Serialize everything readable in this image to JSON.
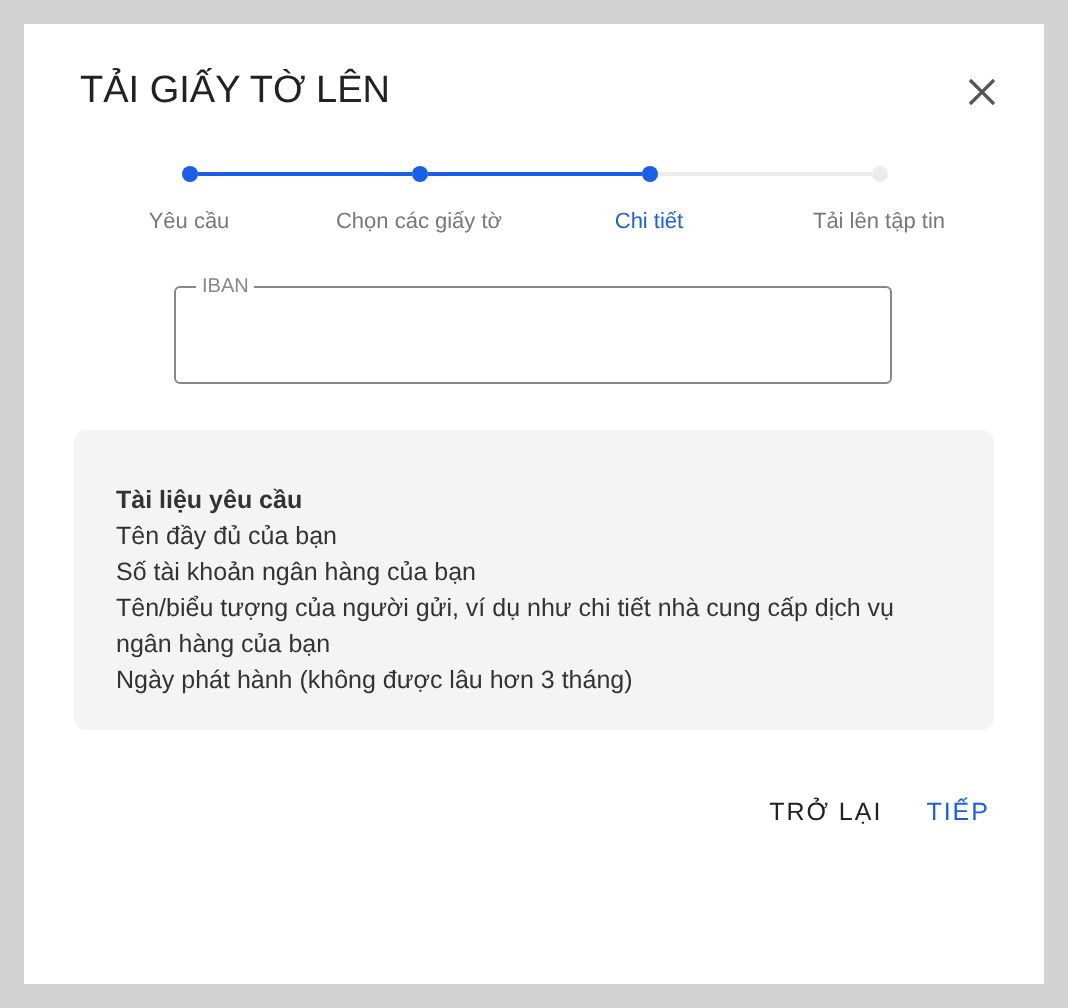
{
  "dialog": {
    "title": "TẢI GIẤY TỜ LÊN"
  },
  "steps": [
    {
      "label": "Yêu cầu",
      "done": true,
      "selected": false
    },
    {
      "label": "Chọn các giấy tờ",
      "done": true,
      "selected": false
    },
    {
      "label": "Chi tiết",
      "done": true,
      "selected": true
    },
    {
      "label": "Tải lên tập tin",
      "done": false,
      "selected": false
    }
  ],
  "field": {
    "label": "IBAN"
  },
  "requirements": {
    "title": "Tài liệu yêu cầu",
    "items": [
      "Tên đầy đủ của bạn",
      "Số tài khoản ngân hàng của bạn",
      "Tên/biểu tượng của người gửi, ví dụ như chi tiết nhà cung cấp dịch vụ ngân hàng của bạn",
      "Ngày phát hành (không được lâu hơn 3 tháng)"
    ]
  },
  "buttons": [
    {
      "label": "TRỞ LẠI",
      "kind": "secondary"
    },
    {
      "label": "TIẾP",
      "kind": "primary"
    }
  ]
}
